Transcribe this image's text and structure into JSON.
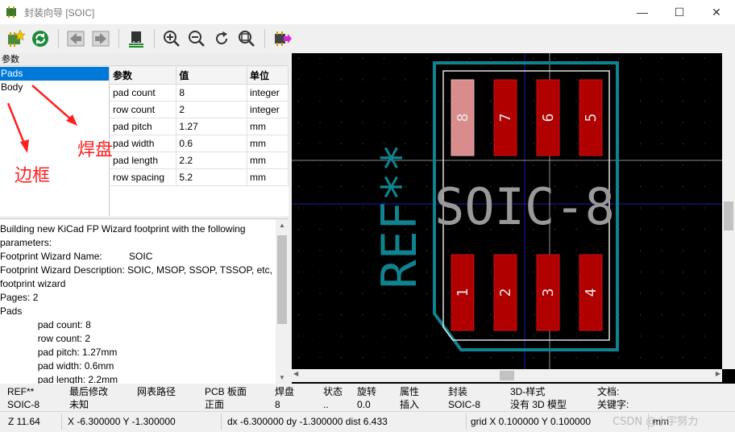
{
  "window": {
    "title": "封装向导 [SOIC]",
    "minimize": "—",
    "maximize": "☐",
    "close": "✕"
  },
  "toolbar": {
    "icons": [
      "select-footprint",
      "refresh",
      "previous-page",
      "next-page",
      "show-3d",
      "zoom-in",
      "zoom-out",
      "redraw",
      "zoom-fit",
      "export-footprint"
    ]
  },
  "left": {
    "caption": "参数",
    "pages": [
      "Pads",
      "Body"
    ],
    "selected_page": "Pads",
    "param_headers": [
      "参数",
      "值",
      "单位"
    ],
    "params": [
      [
        "pad count",
        "8",
        "integer"
      ],
      [
        "row count",
        "2",
        "integer"
      ],
      [
        "pad pitch",
        "1.27",
        "mm"
      ],
      [
        "pad width",
        "0.6",
        "mm"
      ],
      [
        "pad length",
        "2.2",
        "mm"
      ],
      [
        "row spacing",
        "5.2",
        "mm"
      ]
    ],
    "annotations": {
      "pads": "焊盘",
      "body": "边框"
    },
    "messages": "Building new KiCad FP Wizard footprint with the following parameters:\nFootprint Wizard Name:          SOIC\nFootprint Wizard Description: SOIC, MSOP, SSOP, TSSOP, etc, footprint wizard\nPages: 2\nPads\n              pad count: 8\n              row count: 2\n              pad pitch: 1.27mm\n              pad width: 0.6mm\n              pad length: 2.2mm"
  },
  "footprint": {
    "ref_text": "REF**",
    "value_text": "SOIC-8",
    "top_pads": [
      "8",
      "7",
      "6",
      "5"
    ],
    "bottom_pads": [
      "1",
      "2",
      "3",
      "4"
    ],
    "colors": {
      "pad": "#b00000",
      "pad_selected": "#d98c8c",
      "courtyard": "#0f8390",
      "silk": "#e0e0e0",
      "value": "#999999",
      "grid": "#5a5a5a",
      "axis": "#1a1ab0"
    }
  },
  "info": [
    {
      "label": "REF**",
      "value": "SOIC-8"
    },
    {
      "label": "最后修改",
      "value": "未知"
    },
    {
      "label": "网表路径",
      "value": ""
    },
    {
      "label": "PCB 板面",
      "value": "正面"
    },
    {
      "label": "焊盘",
      "value": "8"
    },
    {
      "label": "状态",
      "value": ".."
    },
    {
      "label": "旋转",
      "value": "0.0"
    },
    {
      "label": "属性",
      "value": "插入"
    },
    {
      "label": "封装",
      "value": "SOIC-8"
    },
    {
      "label": "3D-样式",
      "value": "没有 3D 模型"
    },
    {
      "label": "文档:",
      "value": "关键字:"
    }
  ],
  "status": {
    "zoom": "Z 11.64",
    "xy": "X -6.300000  Y -1.300000",
    "dxdy": "dx -6.300000  dy -1.300000  dist 6.433",
    "grid": "grid X 0.100000  Y 0.100000",
    "units": "mm"
  },
  "watermark": "CSDN @小宇努力"
}
